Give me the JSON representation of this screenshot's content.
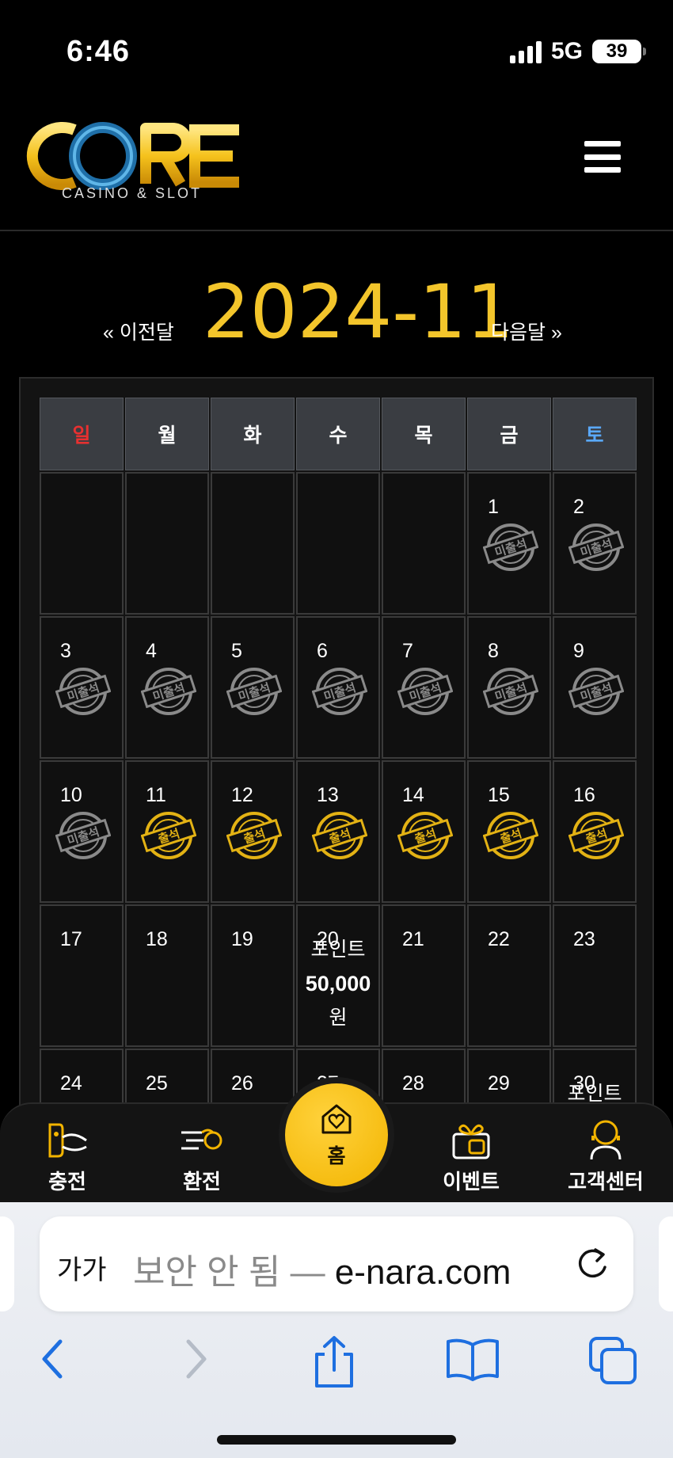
{
  "status": {
    "time": "6:46",
    "network": "5G",
    "battery": "39"
  },
  "header": {
    "logo_text": "CORE",
    "logo_sub": "CASINO & SLOT"
  },
  "calendar": {
    "title": "2024-11",
    "prev_label": "« 이전달",
    "next_label": "다음달 »",
    "weekdays": [
      "일",
      "월",
      "화",
      "수",
      "목",
      "금",
      "토"
    ],
    "stamp_absent": "미출석",
    "stamp_present": "출석",
    "days": [
      {
        "d": "",
        "s": ""
      },
      {
        "d": "",
        "s": ""
      },
      {
        "d": "",
        "s": ""
      },
      {
        "d": "",
        "s": ""
      },
      {
        "d": "",
        "s": ""
      },
      {
        "d": "1",
        "s": "absent"
      },
      {
        "d": "2",
        "s": "absent"
      },
      {
        "d": "3",
        "s": "absent"
      },
      {
        "d": "4",
        "s": "absent"
      },
      {
        "d": "5",
        "s": "absent"
      },
      {
        "d": "6",
        "s": "absent"
      },
      {
        "d": "7",
        "s": "absent"
      },
      {
        "d": "8",
        "s": "absent"
      },
      {
        "d": "9",
        "s": "absent"
      },
      {
        "d": "10",
        "s": "absent"
      },
      {
        "d": "11",
        "s": "present"
      },
      {
        "d": "12",
        "s": "present"
      },
      {
        "d": "13",
        "s": "present"
      },
      {
        "d": "14",
        "s": "present"
      },
      {
        "d": "15",
        "s": "present"
      },
      {
        "d": "16",
        "s": "present"
      },
      {
        "d": "17",
        "s": ""
      },
      {
        "d": "18",
        "s": ""
      },
      {
        "d": "19",
        "s": ""
      },
      {
        "d": "20",
        "s": "",
        "point": {
          "label": "포인트",
          "amount": "50,000",
          "unit": "원"
        }
      },
      {
        "d": "21",
        "s": ""
      },
      {
        "d": "22",
        "s": ""
      },
      {
        "d": "23",
        "s": ""
      },
      {
        "d": "24",
        "s": ""
      },
      {
        "d": "25",
        "s": ""
      },
      {
        "d": "26",
        "s": ""
      },
      {
        "d": "27",
        "s": ""
      },
      {
        "d": "28",
        "s": ""
      },
      {
        "d": "29",
        "s": ""
      },
      {
        "d": "30",
        "s": "",
        "point": {
          "label": "포인트",
          "amount": "",
          "unit": ""
        }
      }
    ]
  },
  "bottom_nav": {
    "deposit": "충전",
    "withdraw": "환전",
    "home": "홈",
    "event": "이벤트",
    "support": "고객센터"
  },
  "browser": {
    "aa_label": "가가",
    "url_prefix": "보안 안 됨 — ",
    "url_host": "e-nara.com"
  }
}
